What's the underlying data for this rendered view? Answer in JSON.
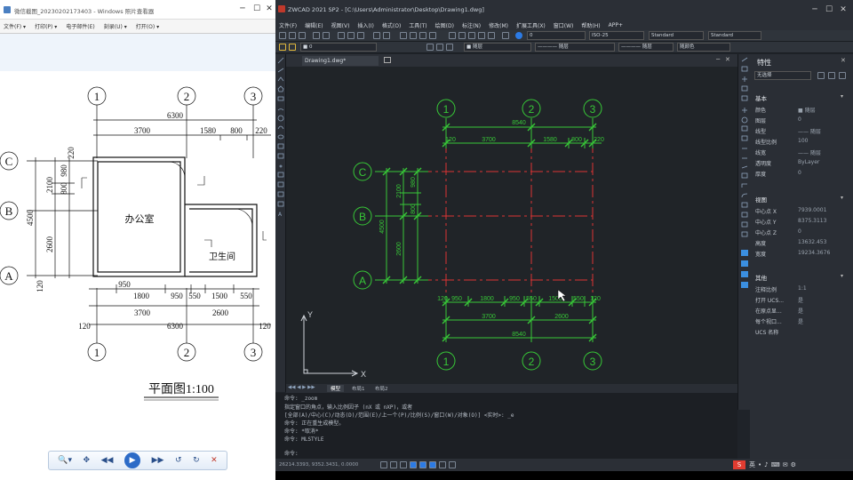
{
  "viewer": {
    "title": "微信截图_20230202173403 - Windows 照片查看器",
    "menu": [
      "文件(F) ▾",
      "打印(P) ▾",
      "电子邮件(E)",
      "刻录(U) ▾",
      "打开(O) ▾"
    ],
    "drawing": {
      "axes_top": [
        "1",
        "2",
        "3"
      ],
      "axes_bottom": [
        "1",
        "2",
        "3"
      ],
      "axes_left": [
        "C",
        "B",
        "A"
      ],
      "dim_total_top": "6300",
      "dims_top": [
        "3700",
        "1580",
        "800",
        "220"
      ],
      "dim_220_a": "220",
      "dims_left": [
        "2100",
        "980",
        "800",
        "2600"
      ],
      "dim_left_total": "4500",
      "dim_120": "120",
      "dims_bottom_1": [
        "950",
        "1800",
        "950",
        "550",
        "1500",
        "550"
      ],
      "dims_bottom_2": [
        "3700",
        "2600"
      ],
      "dim_total_bottom": "6300",
      "dim_120_b": "120",
      "dim_120_c": "120",
      "room1": "办公室",
      "room2": "卫生间",
      "caption": "平面图1:100"
    },
    "controls": {
      "zoom": "🔍▾",
      "fit": "✥",
      "prev": "◀◀",
      "play": "▶",
      "next": "▶▶",
      "rotl": "↺",
      "rotr": "↻",
      "delete": "✕"
    }
  },
  "cad": {
    "title": "ZWCAD 2021 SP2 - [C:\\Users\\Administrator\\Desktop\\Drawing1.dwg]",
    "menu": [
      "文件(F)",
      "编辑(E)",
      "视图(V)",
      "插入(I)",
      "格式(O)",
      "工具(T)",
      "绘图(D)",
      "标注(N)",
      "修改(M)",
      "扩展工具(X)",
      "窗口(W)",
      "帮助(H)",
      "APP+"
    ],
    "toolbar2": {
      "layer_combo": "0",
      "style1": "ISO-25",
      "style2": "Standard",
      "style3": "Standard"
    },
    "toolbar3": {
      "layer": "■ 0",
      "color": "■ 随层",
      "ltype": "———— 随层",
      "lweight": "———— 随层",
      "plot": "随颜色"
    },
    "doc_tab": "Drawing1.dwg*",
    "ucs": {
      "y": "Y",
      "x": "X"
    },
    "layout_tabs": [
      "模型",
      "布局1",
      "布局2"
    ],
    "cad_drawing": {
      "axes_top": [
        "1",
        "2",
        "3"
      ],
      "axes_bottom": [
        "1",
        "2",
        "3"
      ],
      "axes_left": [
        "C",
        "B",
        "A"
      ],
      "dim_total_top": "8540",
      "dims_top": [
        "120",
        "3700",
        "1580",
        "800",
        "220"
      ],
      "dims_left": [
        "2100",
        "980",
        "800",
        "2600"
      ],
      "dim_left_total": "4500",
      "dims_bottom_1": [
        "120",
        "950",
        "1800",
        "950",
        "550",
        "1500",
        "550",
        "120"
      ],
      "dims_bottom_2": [
        "3700",
        "2600"
      ],
      "dim_total_bottom": "8540"
    },
    "command_lines": [
      "命令: _zoom",
      "指定窗口的角点，输入比例因子 (nX 或 nXP)，或者",
      "[全部(A)/中心(C)/动态(D)/范围(E)/上一个(P)/比例(S)/窗口(W)/对象(O)] <实时>: _e",
      "命令: 正在重生成模型。",
      "命令: *取消*",
      "命令: MLSTYLE"
    ],
    "command_prompt": "命令:",
    "coords": "26214.3393, 9352.3431, 0.0000",
    "props": {
      "header": "特性",
      "selection": "无选择",
      "sec_general": "基本",
      "general": [
        [
          "颜色",
          "■ 随层"
        ],
        [
          "图层",
          "0"
        ],
        [
          "线型",
          "—— 随层"
        ],
        [
          "线型比例",
          "100"
        ],
        [
          "线宽",
          "—— 随层"
        ],
        [
          "透明度",
          "ByLayer"
        ],
        [
          "厚度",
          "0"
        ]
      ],
      "sec_view": "视图",
      "view": [
        [
          "中心点 X",
          "7939.0001"
        ],
        [
          "中心点 Y",
          "8375.3113"
        ],
        [
          "中心点 Z",
          "0"
        ],
        [
          "高度",
          "13632.453"
        ],
        [
          "宽度",
          "19234.3676"
        ]
      ],
      "sec_misc": "其他",
      "misc": [
        [
          "注释比例",
          "1:1"
        ],
        [
          "打开 UCS...",
          "是"
        ],
        [
          "在原点显...",
          "是"
        ],
        [
          "每个视口...",
          "是"
        ],
        [
          "UCS 名称",
          ""
        ]
      ]
    }
  }
}
